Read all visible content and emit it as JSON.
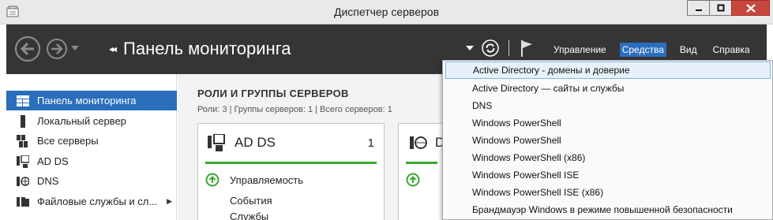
{
  "window": {
    "title": "Диспетчер серверов",
    "close_color": "#c7483f"
  },
  "header": {
    "page_title": "Панель мониторинга",
    "menu": [
      {
        "label": "Управление",
        "active": false
      },
      {
        "label": "Средства",
        "active": true
      },
      {
        "label": "Вид",
        "active": false
      },
      {
        "label": "Справка",
        "active": false
      }
    ],
    "colors": {
      "background": "#353535",
      "accent": "#2a6ebc"
    }
  },
  "sidebar": {
    "items": [
      {
        "label": "Панель мониторинга",
        "icon": "dashboard-icon",
        "active": true
      },
      {
        "label": "Локальный сервер",
        "icon": "local-server-icon",
        "active": false
      },
      {
        "label": "Все серверы",
        "icon": "all-servers-icon",
        "active": false
      },
      {
        "label": "AD DS",
        "icon": "ad-ds-icon",
        "active": false
      },
      {
        "label": "DNS",
        "icon": "dns-icon",
        "active": false
      },
      {
        "label": "Файловые службы и сл...",
        "icon": "file-services-icon",
        "active": false,
        "has_submenu": true
      }
    ]
  },
  "main": {
    "section_title": "РОЛИ И ГРУППЫ СЕРВЕРОВ",
    "section_subtitle": "Роли: 3 | Группы серверов: 1 | Всего серверов: 1",
    "cards": [
      {
        "name": "AD DS",
        "count": "1",
        "rows": [
          {
            "label": "Управляемость",
            "icon": "status-ok-icon"
          },
          {
            "label": "События"
          },
          {
            "label": "Службы"
          }
        ]
      },
      {
        "name": "D",
        "count": "",
        "rows": []
      }
    ],
    "status_color": "#3aa832"
  },
  "tools_menu": {
    "items": [
      {
        "label": "Active Directory - домены и доверие",
        "hover": true
      },
      {
        "label": "Active Directory — сайты и службы"
      },
      {
        "label": "DNS"
      },
      {
        "label": "Windows PowerShell"
      },
      {
        "label": "Windows PowerShell"
      },
      {
        "label": "Windows PowerShell (x86)"
      },
      {
        "label": "Windows PowerShell ISE"
      },
      {
        "label": "Windows PowerShell ISE (x86)"
      },
      {
        "label": "Брандмауэр Windows в режиме повышенной безопасности"
      }
    ]
  }
}
